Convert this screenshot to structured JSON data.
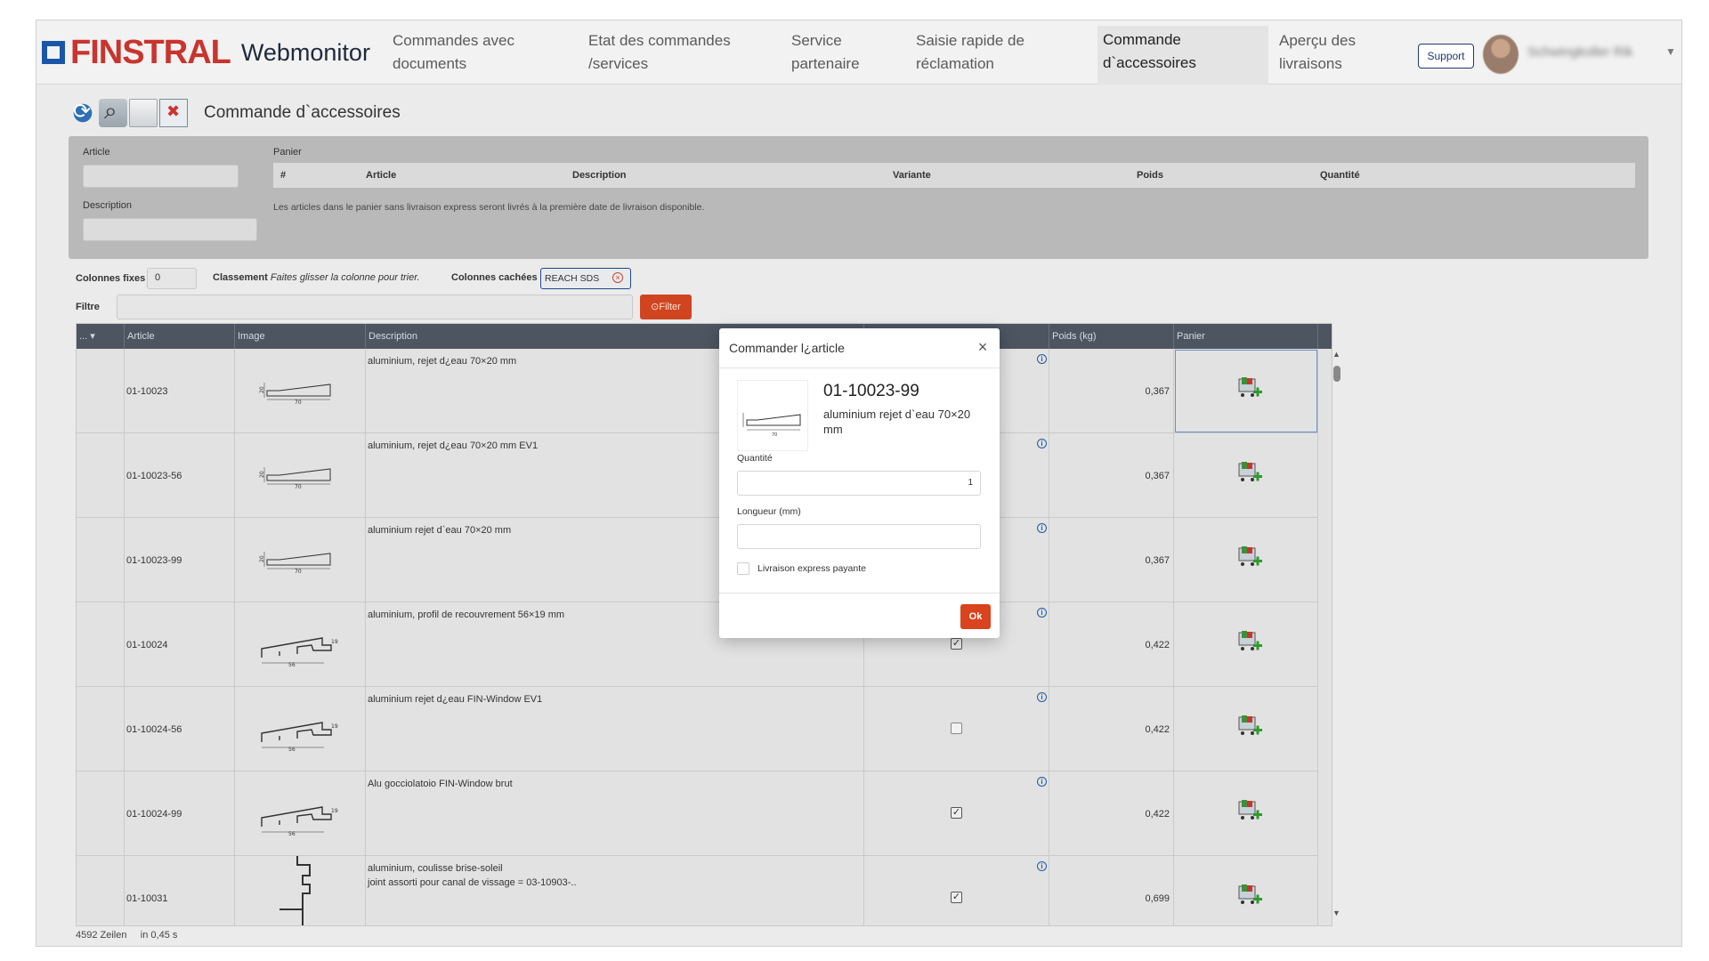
{
  "app": {
    "brand": "FINSTRAL",
    "product": "Webmonitor"
  },
  "nav": {
    "items": [
      {
        "label": "Commandes avec documents"
      },
      {
        "label": "Etat des commandes /services"
      },
      {
        "label": "Service partenaire"
      },
      {
        "label": "Saisie rapide de réclamation"
      },
      {
        "label": "Commande d`accessoires",
        "active": true
      },
      {
        "label": "Aperçu des livraisons"
      }
    ],
    "support_label": "Support",
    "user_name": "Schwingkoller Rik"
  },
  "toolbar": {
    "icons": [
      "refresh-icon",
      "search-icon",
      "copy-icon",
      "delete-icon"
    ],
    "title": "Commande d`accessoires"
  },
  "panel": {
    "article_label": "Article",
    "description_label": "Description",
    "cart_label": "Panier",
    "cart_columns": [
      "#",
      "Article",
      "Description",
      "Variante",
      "Poids",
      "Quantité"
    ],
    "cart_note": "Les articles dans le panier sans livraison express seront livrés à la première date de livraison disponible."
  },
  "filters": {
    "fixed_columns_label": "Colonnes fixes",
    "fixed_columns_value": "0",
    "sort_label": "Classement",
    "sort_hint": "Faites glisser la colonne pour trier.",
    "hidden_columns_label": "Colonnes cachées",
    "hidden_tag": "REACH SDS",
    "filter_label": "Filtre",
    "filter_button": "Filter"
  },
  "grid": {
    "columns": [
      "...",
      "Article",
      "Image",
      "Description",
      "",
      "Poids (kg)",
      "Panier"
    ],
    "rows": [
      {
        "article": "01-10023",
        "description": "aluminium, rejet d¿eau 70×20 mm",
        "checked": null,
        "poids": "0,367"
      },
      {
        "article": "01-10023-56",
        "description": "aluminium, rejet d¿eau 70×20 mm EV1",
        "checked": null,
        "poids": "0,367"
      },
      {
        "article": "01-10023-99",
        "description": "aluminium rejet d`eau 70×20 mm",
        "checked": null,
        "poids": "0,367"
      },
      {
        "article": "01-10024",
        "description": "aluminium, profil de recouvrement 56×19 mm",
        "checked": true,
        "poids": "0,422"
      },
      {
        "article": "01-10024-56",
        "description": "aluminium rejet d¿eau FIN-Window EV1",
        "checked": false,
        "poids": "0,422"
      },
      {
        "article": "01-10024-99",
        "description": "Alu gocciolatoio FIN-Window brut",
        "checked": true,
        "poids": "0,422"
      },
      {
        "article": "01-10031",
        "description": "aluminium, coulisse brise-soleil\njoint assorti pour canal de vissage = 03-10903-..",
        "checked": true,
        "poids": "0,699"
      }
    ],
    "status_rows": "4592 Zeilen",
    "status_time": "in 0,45 s"
  },
  "modal": {
    "title": "Commander l¿article",
    "code": "01-10023-99",
    "description": "aluminium rejet d`eau 70×20 mm",
    "quantity_label": "Quantité",
    "quantity_value": "1",
    "length_label": "Longueur (mm)",
    "length_value": "",
    "express_label": "Livraison express payante",
    "ok_label": "Ok"
  },
  "colors": {
    "brand_red": "#c8352e",
    "brand_blue": "#1a56a8",
    "accent_orange": "#d9431d",
    "grid_header": "#4c5560"
  }
}
